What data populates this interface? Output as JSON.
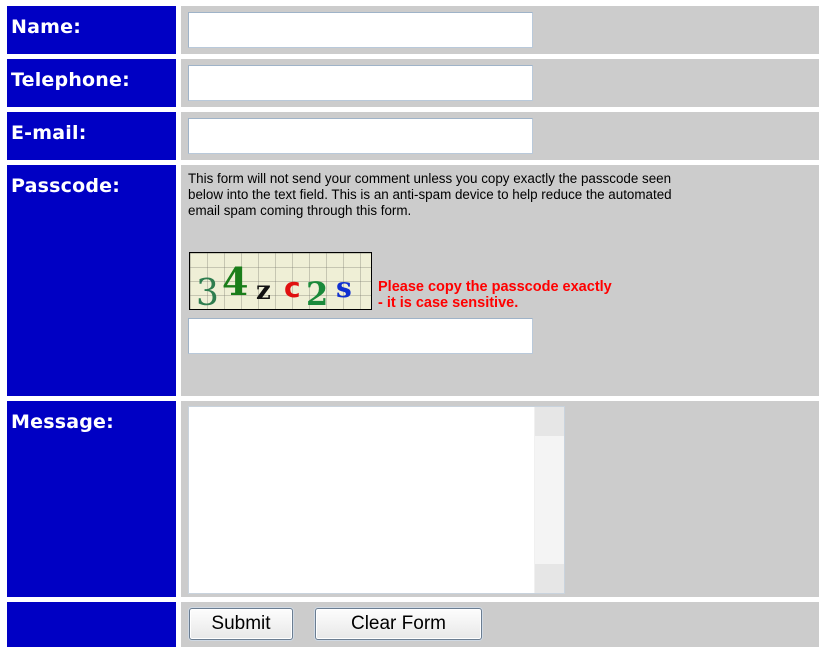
{
  "form": {
    "name": {
      "label": "Name:",
      "value": ""
    },
    "telephone": {
      "label": "Telephone:",
      "value": ""
    },
    "email": {
      "label": "E-mail:",
      "value": ""
    },
    "passcode": {
      "label": "Passcode:",
      "intro_lines": [
        "This form will not send your comment unless you copy exactly the passcode seen",
        "below into the text field. This is an anti-spam device to help reduce the automated",
        "email spam coming through this form."
      ],
      "captcha_chars": [
        "3",
        "4",
        "z",
        "c",
        "2",
        "s"
      ],
      "captcha_colors": [
        "#2e7d4f",
        "#1a7d1a",
        "#111111",
        "#e01010",
        "#1a8a3a",
        "#1030d0"
      ],
      "note_lines": [
        "Please copy the passcode exactly",
        "- it is case sensitive."
      ],
      "value": ""
    },
    "message": {
      "label": "Message:",
      "value": ""
    },
    "buttons": {
      "submit": "Submit",
      "clear": "Clear Form"
    }
  },
  "colors": {
    "label_bg": "#0000c4",
    "label_text": "#ffffff",
    "cell_bg": "#cccccc",
    "note_text": "#ff0000"
  }
}
